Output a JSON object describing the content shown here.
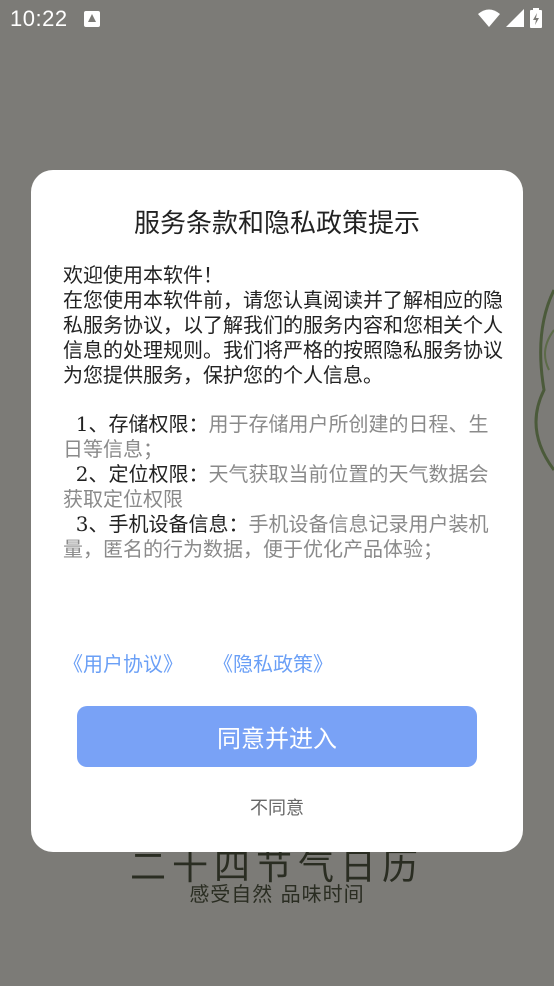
{
  "status_bar": {
    "time": "10:22"
  },
  "background": {
    "title": "二十四节气日历",
    "subtitle": "感受自然  品味时间"
  },
  "dialog": {
    "title": "服务条款和隐私政策提示",
    "greeting": "欢迎使用本软件！",
    "intro": "在您使用本软件前，请您认真阅读并了解相应的隐私服务协议，以了解我们的服务内容和您相关个人信息的处理规则。我们将严格的按照隐私服务协议为您提供服务，保护您的个人信息。",
    "permissions": [
      {
        "label": "1、存储权限：",
        "desc": "用于存储用户所创建的日程、生日等信息；"
      },
      {
        "label": "2、定位权限：",
        "desc": "天气获取当前位置的天气数据会获取定位权限"
      },
      {
        "label": "3、手机设备信息：",
        "desc": "手机设备信息记录用户装机量，匿名的行为数据，便于优化产品体验；"
      }
    ],
    "user_agreement_link": "《用户协议》",
    "privacy_policy_link": "《隐私政策》",
    "agree_label": "同意并进入",
    "disagree_label": "不同意"
  },
  "colors": {
    "link": "#6a9ff6",
    "primary_button": "#79a2f6",
    "overlay": "#7c7b77"
  }
}
